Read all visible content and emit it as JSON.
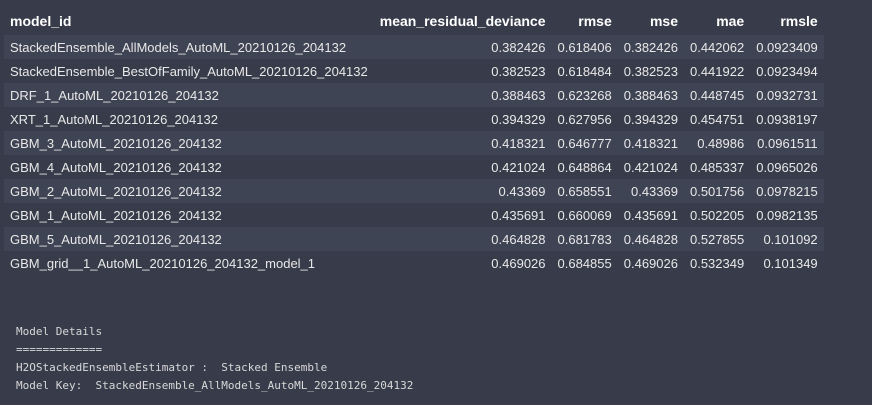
{
  "leaderboard": {
    "columns": [
      "model_id",
      "mean_residual_deviance",
      "rmse",
      "mse",
      "mae",
      "rmsle"
    ],
    "rows": [
      [
        "StackedEnsemble_AllModels_AutoML_20210126_204132",
        "0.382426",
        "0.618406",
        "0.382426",
        "0.442062",
        "0.0923409"
      ],
      [
        "StackedEnsemble_BestOfFamily_AutoML_20210126_204132",
        "0.382523",
        "0.618484",
        "0.382523",
        "0.441922",
        "0.0923494"
      ],
      [
        "DRF_1_AutoML_20210126_204132",
        "0.388463",
        "0.623268",
        "0.388463",
        "0.448745",
        "0.0932731"
      ],
      [
        "XRT_1_AutoML_20210126_204132",
        "0.394329",
        "0.627956",
        "0.394329",
        "0.454751",
        "0.0938197"
      ],
      [
        "GBM_3_AutoML_20210126_204132",
        "0.418321",
        "0.646777",
        "0.418321",
        "0.48986",
        "0.0961511"
      ],
      [
        "GBM_4_AutoML_20210126_204132",
        "0.421024",
        "0.648864",
        "0.421024",
        "0.485337",
        "0.0965026"
      ],
      [
        "GBM_2_AutoML_20210126_204132",
        "0.43369",
        "0.658551",
        "0.43369",
        "0.501756",
        "0.0978215"
      ],
      [
        "GBM_1_AutoML_20210126_204132",
        "0.435691",
        "0.660069",
        "0.435691",
        "0.502205",
        "0.0982135"
      ],
      [
        "GBM_5_AutoML_20210126_204132",
        "0.464828",
        "0.681783",
        "0.464828",
        "0.527855",
        "0.101092"
      ],
      [
        "GBM_grid__1_AutoML_20210126_204132_model_1",
        "0.469026",
        "0.684855",
        "0.469026",
        "0.532349",
        "0.101349"
      ]
    ]
  },
  "output": {
    "lines": [
      "Model Details",
      "=============",
      "H2OStackedEnsembleEstimator :  Stacked Ensemble",
      "Model Key:  StackedEnsemble_AllModels_AutoML_20210126_204132"
    ]
  }
}
